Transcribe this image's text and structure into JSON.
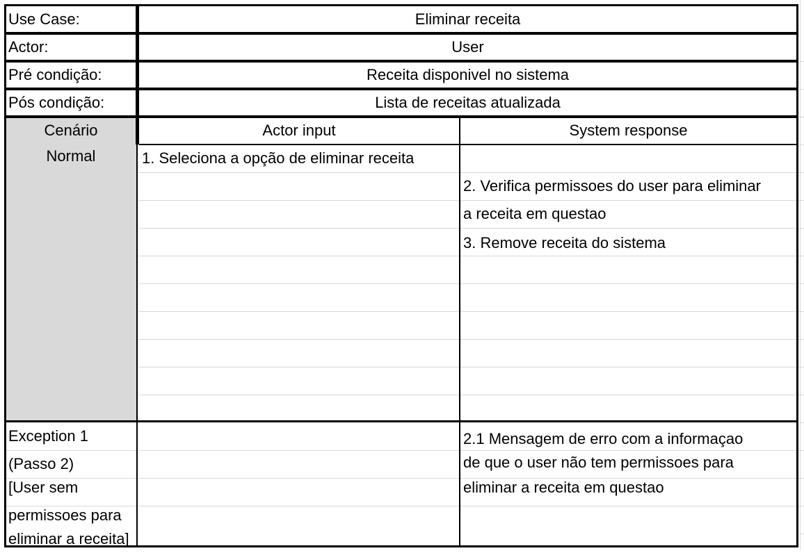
{
  "header_rows": [
    {
      "label": "Use Case:",
      "value": "Eliminar receita"
    },
    {
      "label": "Actor:",
      "value": "User"
    },
    {
      "label": "Pré condição:",
      "value": "Receita disponivel no sistema"
    },
    {
      "label": "Pós condição:",
      "value": "Lista de receitas atualizada"
    }
  ],
  "scenario": {
    "label_line1": "Cenário",
    "label_line2": "Normal",
    "col_actor": "Actor input",
    "col_system": "System response",
    "actor_steps": [
      "1. Seleciona a opção de eliminar receita"
    ],
    "system_steps": [
      "2. Verifica permissoes do user para eliminar",
      "a receita em questao",
      "3. Remove receita do sistema"
    ]
  },
  "exception": {
    "label_lines": [
      "Exception 1",
      "(Passo 2)",
      "[User sem",
      "permissoes para",
      "eliminar a receita]"
    ],
    "system_lines": [
      "2.1 Mensagem de erro com a informaçao",
      "de que o user não tem permissoes para",
      "eliminar a receita em questao"
    ]
  }
}
